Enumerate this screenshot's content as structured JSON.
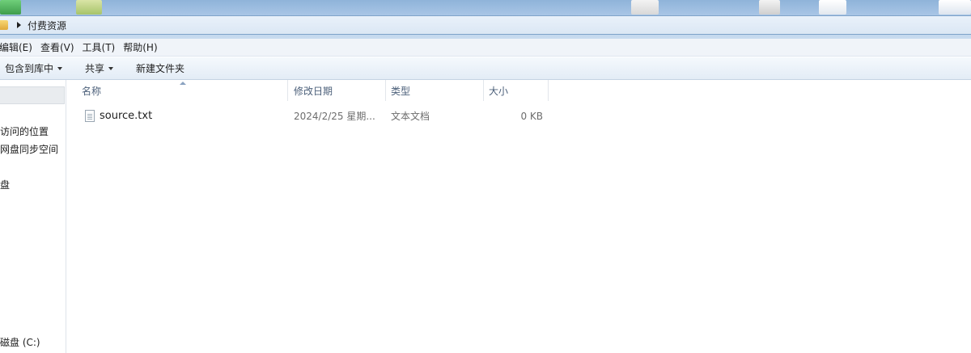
{
  "address": {
    "breadcrumb": "付费资源"
  },
  "menu": {
    "edit": "编辑(E)",
    "view": "查看(V)",
    "tools": "工具(T)",
    "help": "帮助(H)"
  },
  "toolbar": {
    "include_in_library": "包含到库中",
    "share": "共享",
    "new_folder": "新建文件夹"
  },
  "nav": {
    "items": [
      "访问的位置",
      "网盘同步空间",
      "盘",
      "磁盘 (C:)"
    ]
  },
  "columns": {
    "name": "名称",
    "modified": "修改日期",
    "type": "类型",
    "size": "大小"
  },
  "files": [
    {
      "name": "source.txt",
      "modified": "2024/2/25 星期...",
      "type": "文本文档",
      "size": "0 KB",
      "icon": "text-file-icon"
    }
  ],
  "colors": {
    "titlebar": "#a9c6e6",
    "header_text": "#4c607a",
    "secondary_text": "#6d6d6d"
  }
}
